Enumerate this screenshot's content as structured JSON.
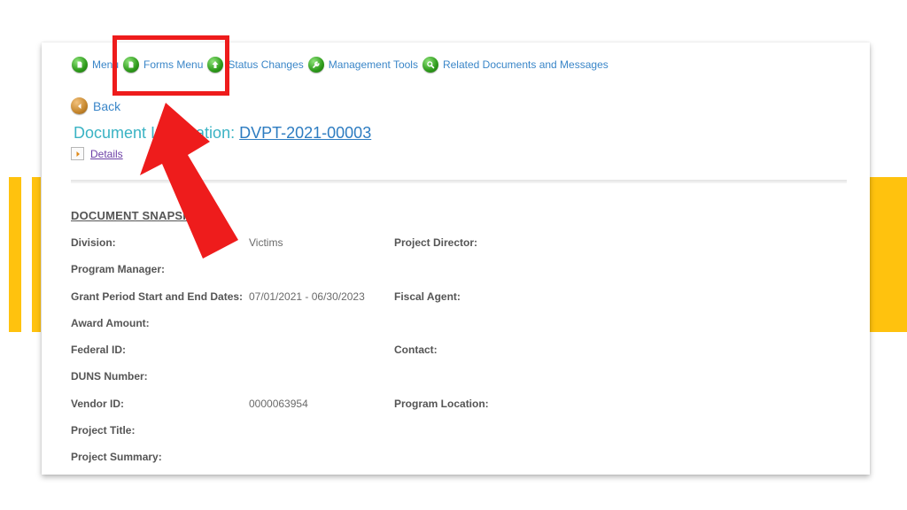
{
  "nav": {
    "items": [
      {
        "label": "Menu",
        "icon": "document-icon"
      },
      {
        "label": "Forms Menu",
        "icon": "document-icon"
      },
      {
        "label": "Status Changes",
        "icon": "arrow-up-icon"
      },
      {
        "label": "Management Tools",
        "icon": "wrench-icon"
      },
      {
        "label": "Related Documents and Messages",
        "icon": "magnifier-icon"
      }
    ]
  },
  "back_label": "Back",
  "document": {
    "title_prefix": "Document Information:",
    "id": "DVPT-2021-00003"
  },
  "details_label": "Details",
  "snapshot": {
    "title": "DOCUMENT SNAPSHOT",
    "left_fields": [
      {
        "label": "Division:",
        "value": "Victims"
      },
      {
        "label": "Program Manager:",
        "value": ""
      },
      {
        "label": "Grant Period Start and End Dates:",
        "value": "07/01/2021 - 06/30/2023"
      },
      {
        "label": "Award Amount:",
        "value": ""
      },
      {
        "label": "Federal ID:",
        "value": ""
      },
      {
        "label": "DUNS Number:",
        "value": ""
      },
      {
        "label": "Vendor ID:",
        "value": "0000063954"
      },
      {
        "label": "Project Title:",
        "value": ""
      },
      {
        "label": "Project Summary:",
        "value": ""
      }
    ],
    "right_fields": [
      {
        "label": "Project Director:",
        "value": ""
      },
      {
        "label": "Fiscal Agent:",
        "value": ""
      },
      {
        "label": "Contact:",
        "value": ""
      },
      {
        "label": "Program Location:",
        "value": ""
      }
    ]
  },
  "colors": {
    "accent_yellow": "#FFC20E",
    "annotation_red": "#EE1C1C",
    "link_blue": "#3A86C8",
    "title_teal": "#3AB3C4"
  }
}
